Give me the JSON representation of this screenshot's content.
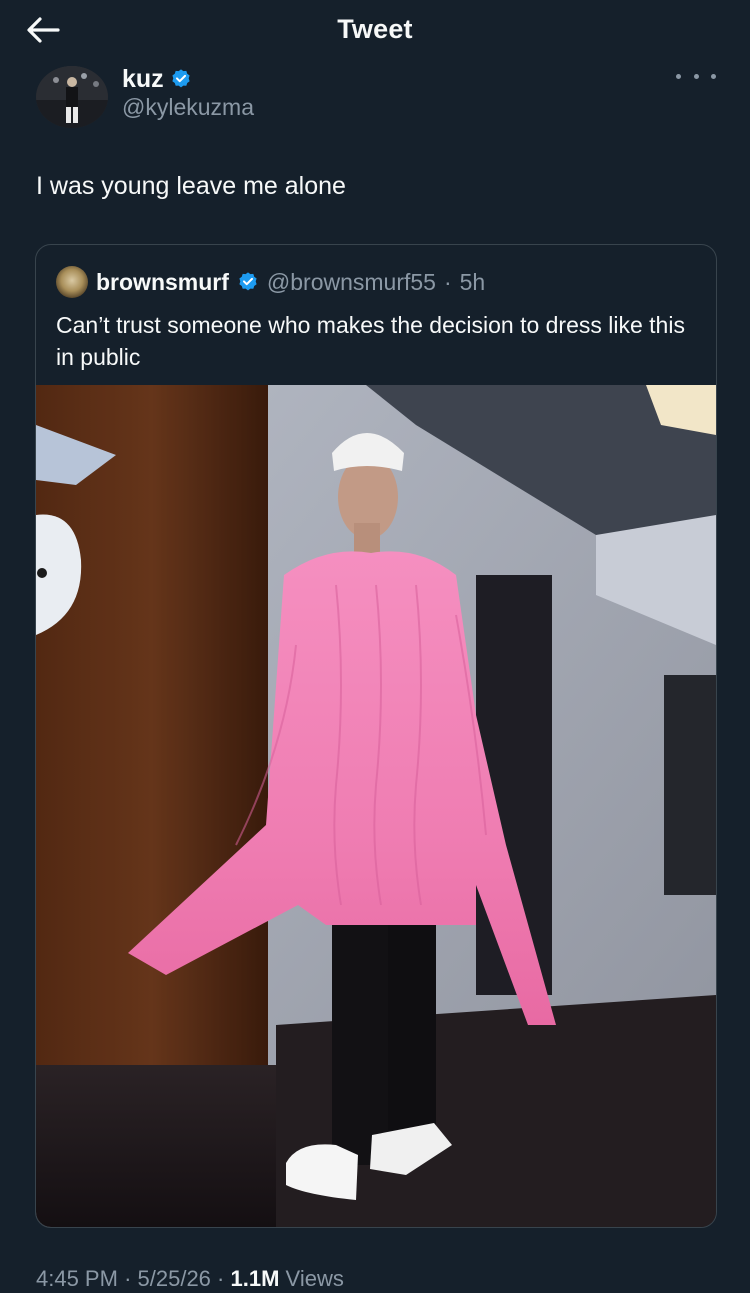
{
  "header": {
    "title": "Tweet",
    "back_icon": "arrow-left-icon"
  },
  "tweet": {
    "author": {
      "name": "kuz",
      "handle": "@kylekuzma",
      "verified": true
    },
    "text": "I was young leave me alone",
    "time": "4:45 PM",
    "date": "5/25/26",
    "separator": "·",
    "views_count": "1.1M",
    "views_label": "Views"
  },
  "quote": {
    "author": {
      "name": "brownsmurf",
      "handle": "@brownsmurf55",
      "verified": true
    },
    "separator": "·",
    "time": "5h",
    "text": "Can’t trust someone  who makes the decision to dress like this in public"
  },
  "colors": {
    "background": "#15202b",
    "text": "#f7f9f9",
    "muted": "#8b98a5",
    "border": "#38444d",
    "verified": "#1d9bf0"
  }
}
